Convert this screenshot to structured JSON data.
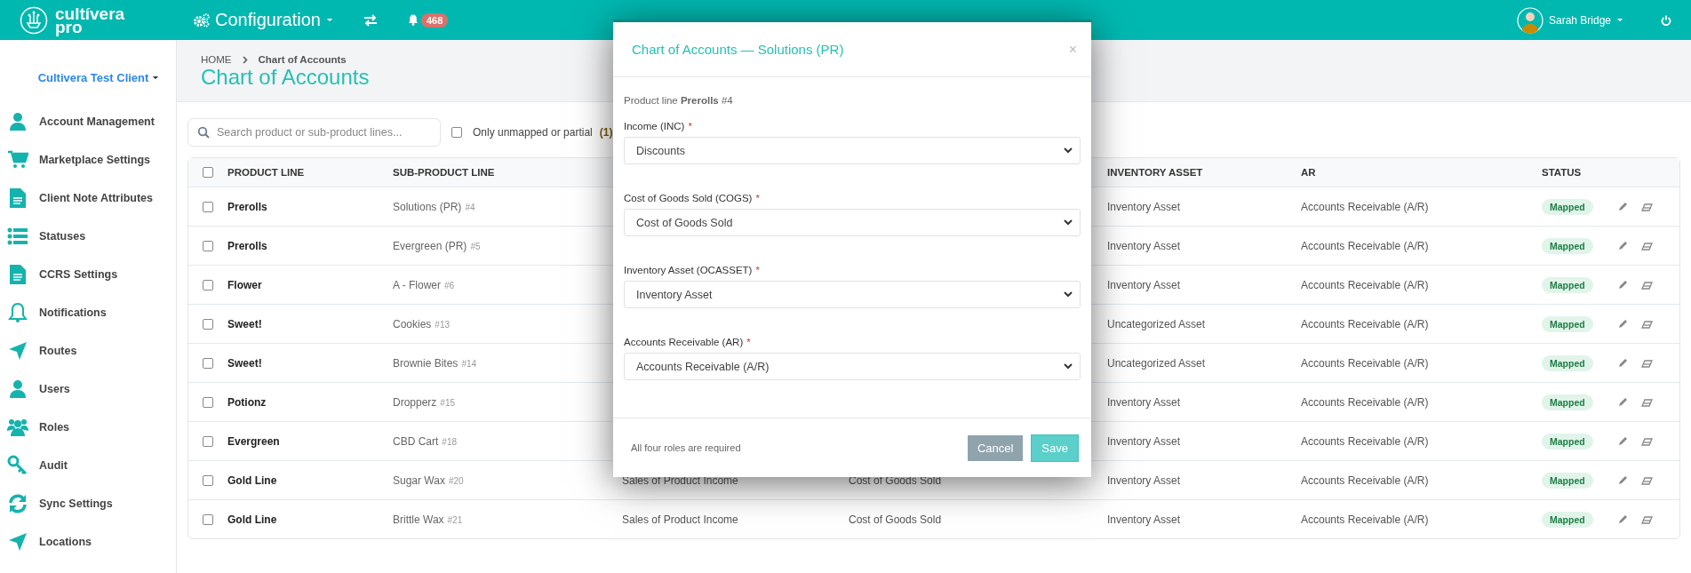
{
  "topbar": {
    "brand": {
      "name": "cultívera",
      "sub": "pro"
    },
    "menu": {
      "label": "Configuration"
    },
    "notifications": {
      "count": "468"
    },
    "user": {
      "name": "Sarah Bridge"
    }
  },
  "sidebar": {
    "client": "Cultivera Test Client",
    "items": [
      {
        "kind": "user",
        "label": "Account Management"
      },
      {
        "kind": "cart",
        "label": "Marketplace Settings"
      },
      {
        "kind": "doc",
        "label": "Client Note Attributes"
      },
      {
        "kind": "list",
        "label": "Statuses"
      },
      {
        "kind": "doc",
        "label": "CCRS Settings"
      },
      {
        "kind": "bell",
        "label": "Notifications"
      },
      {
        "kind": "arrow",
        "label": "Routes"
      },
      {
        "kind": "user",
        "label": "Users"
      },
      {
        "kind": "group",
        "label": "Roles"
      },
      {
        "kind": "key",
        "label": "Audit"
      },
      {
        "kind": "sync",
        "label": "Sync Settings"
      },
      {
        "kind": "arrow",
        "label": "Locations"
      }
    ]
  },
  "breadcrumb": {
    "home": "HOME",
    "current": "Chart of Accounts"
  },
  "page_title": "Chart of Accounts",
  "filters": {
    "search": {
      "placeholder": "Search product or sub-product lines..."
    },
    "unmapped": {
      "label": "Only unmapped or partial",
      "count": "(1)",
      "checked": false
    }
  },
  "table": {
    "select_all_checked": false,
    "columns": {
      "product_line": "PRODUCT LINE",
      "sub_product_line": "SUB-PRODUCT LINE",
      "inventory_asset": "INVENTORY ASSET",
      "ar": "AR",
      "status": "STATUS"
    },
    "rows": [
      {
        "checked": false,
        "product_line": "Prerolls",
        "sub_product_line": "Solutions (PR)",
        "sub_id": "#4",
        "inventory_asset": "Inventory Asset",
        "ar": "Accounts Receivable (A/R)",
        "status": "Mapped"
      },
      {
        "checked": false,
        "product_line": "Prerolls",
        "sub_product_line": "Evergreen (PR)",
        "sub_id": "#5",
        "inventory_asset": "Inventory Asset",
        "ar": "Accounts Receivable (A/R)",
        "status": "Mapped"
      },
      {
        "checked": false,
        "product_line": "Flower",
        "sub_product_line": "A - Flower",
        "sub_id": "#6",
        "inventory_asset": "Inventory Asset",
        "ar": "Accounts Receivable (A/R)",
        "status": "Mapped"
      },
      {
        "checked": false,
        "product_line": "Sweet!",
        "sub_product_line": "Cookies",
        "sub_id": "#13",
        "inventory_asset": "Uncategorized Asset",
        "ar": "Accounts Receivable (A/R)",
        "status": "Mapped"
      },
      {
        "checked": false,
        "product_line": "Sweet!",
        "sub_product_line": "Brownie Bites",
        "sub_id": "#14",
        "inventory_asset": "Uncategorized Asset",
        "ar": "Accounts Receivable (A/R)",
        "status": "Mapped"
      },
      {
        "checked": false,
        "product_line": "Potionz",
        "sub_product_line": "Dropperz",
        "sub_id": "#15",
        "inventory_asset": "Inventory Asset",
        "ar": "Accounts Receivable (A/R)",
        "status": "Mapped"
      },
      {
        "checked": false,
        "product_line": "Evergreen",
        "sub_product_line": "CBD Cart",
        "sub_id": "#18",
        "inventory_asset": "Inventory Asset",
        "ar": "Accounts Receivable (A/R)",
        "status": "Mapped"
      },
      {
        "checked": false,
        "product_line": "Gold Line",
        "sub_product_line": "Sugar Wax",
        "sub_id": "#20",
        "income": "Sales of Product Income",
        "cogs": "Cost of Goods Sold",
        "inventory_asset": "Inventory Asset",
        "ar": "Accounts Receivable (A/R)",
        "status": "Mapped"
      },
      {
        "checked": false,
        "product_line": "Gold Line",
        "sub_product_line": "Brittle Wax",
        "sub_id": "#21",
        "income": "Sales of Product Income",
        "cogs": "Cost of Goods Sold",
        "inventory_asset": "Inventory Asset",
        "ar": "Accounts Receivable (A/R)",
        "status": "Mapped"
      }
    ]
  },
  "modal": {
    "title": "Chart of Accounts — Solutions (PR)",
    "close": "×",
    "product_line": "Product line **Prerolls** #4",
    "fields": [
      {
        "label": "Income (INC)",
        "required_mark": "*",
        "value": "Discounts"
      },
      {
        "label": "Cost of Goods Sold (COGS)",
        "required_mark": "*",
        "value": "Cost of Goods Sold"
      },
      {
        "label": "Inventory Asset (OCASSET)",
        "required_mark": "*",
        "value": "Inventory Asset"
      },
      {
        "label": "Accounts Receivable (AR)",
        "required_mark": "*",
        "value": "Accounts Receivable (A/R)"
      }
    ],
    "note": "All four roles are required",
    "buttons": [
      {
        "kind": "cancel",
        "label": "Cancel"
      },
      {
        "kind": "save",
        "label": "Save"
      }
    ]
  }
}
